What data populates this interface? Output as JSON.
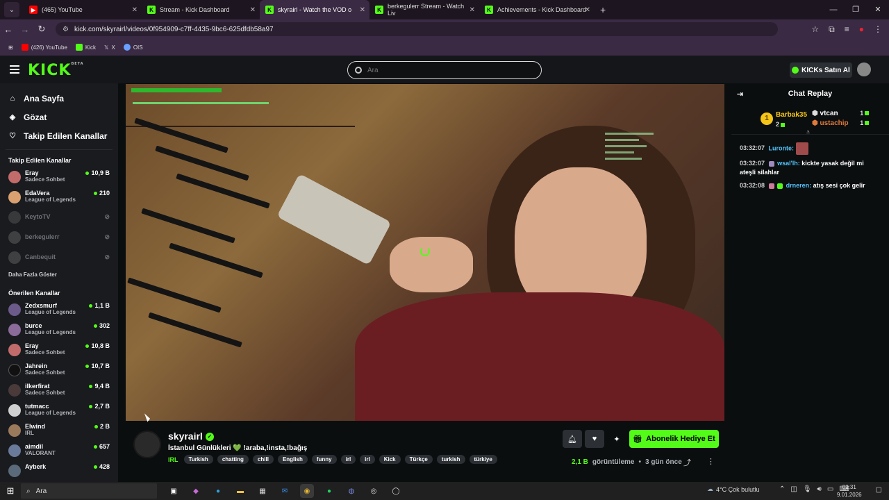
{
  "browser": {
    "tabs": [
      {
        "label": "(465) YouTube",
        "icon": "youtube-icon",
        "color": "#ff0000"
      },
      {
        "label": "Stream - Kick Dashboard",
        "icon": "kick-icon",
        "color": "#53fc18"
      },
      {
        "label": "skyrairl - Watch the VOD o",
        "icon": "kick-icon",
        "color": "#53fc18"
      },
      {
        "label": "berkegulerr Stream - Watch Liv",
        "icon": "kick-icon",
        "color": "#53fc18"
      },
      {
        "label": "Achievements - Kick Dashboard",
        "icon": "kick-icon",
        "color": "#53fc18"
      }
    ],
    "url": "kick.com/skyrairl/videos/0f954909-c7ff-4435-9bc6-625dfdb58a97",
    "bookmarks": [
      {
        "label": "(426) YouTube",
        "icon": "youtube-icon",
        "color": "#ff0000"
      },
      {
        "label": "Kick",
        "icon": "kick-icon",
        "color": "#53fc18"
      },
      {
        "label": "X",
        "icon": "x-icon",
        "color": "#ffffff"
      },
      {
        "label": "OIS",
        "icon": "globe-icon",
        "color": "#6aa0ff"
      }
    ]
  },
  "header": {
    "logo": "KICK",
    "logo_badge": "BETA",
    "search_placeholder": "Ara",
    "kicks_button": "KICKs Satın Al"
  },
  "sidebar": {
    "nav": [
      {
        "label": "Ana Sayfa",
        "icon": "home-icon"
      },
      {
        "label": "Gözat",
        "icon": "compass-icon"
      },
      {
        "label": "Takip Edilen Kanallar",
        "icon": "heart-icon"
      }
    ],
    "followed_title": "Takip Edilen Kanallar",
    "followed": [
      {
        "name": "Eray",
        "category": "Sadece Sohbet",
        "viewers": "10,9 B",
        "color": "#c26b6b"
      },
      {
        "name": "EdaVera",
        "category": "League of Legends",
        "viewers": "210",
        "color": "#d9a070"
      },
      {
        "name": "KeytoTV",
        "offline": true,
        "color": "#666"
      },
      {
        "name": "berkegulerr",
        "offline": true,
        "color": "#777"
      },
      {
        "name": "Canbequit",
        "offline": true,
        "color": "#777"
      }
    ],
    "show_more": "Daha Fazla Göster",
    "recommended_title": "Önerilen Kanallar",
    "recommended": [
      {
        "name": "Zedxsmurf",
        "category": "League of Legends",
        "viewers": "1,1 B",
        "color": "#6b5a8a"
      },
      {
        "name": "burce",
        "category": "League of Legends",
        "viewers": "302",
        "color": "#8a6b9a"
      },
      {
        "name": "Eray",
        "category": "Sadece Sohbet",
        "viewers": "10,8 B",
        "color": "#c26b6b"
      },
      {
        "name": "Jahrein",
        "category": "Sadece Sohbet",
        "viewers": "10,7 B",
        "color": "#111"
      },
      {
        "name": "ilkerfirat",
        "category": "Sadece Sohbet",
        "viewers": "9,4 B",
        "color": "#4a3a3a"
      },
      {
        "name": "tutmacc",
        "category": "League of Legends",
        "viewers": "2,7 B",
        "color": "#d0d0d0"
      },
      {
        "name": "Elwind",
        "category": "IRL",
        "viewers": "2 B",
        "color": "#9a7a5a"
      },
      {
        "name": "aimdil",
        "category": "VALORANT",
        "viewers": "657",
        "color": "#6a7a9a"
      },
      {
        "name": "Ayberk",
        "category": "",
        "viewers": "428",
        "color": "#5a6a7a"
      }
    ]
  },
  "stream": {
    "name": "skyrairl",
    "title": "İstanbul Günlükleri 💚  !araba,!insta,!bağış",
    "category": "IRL",
    "tags": [
      "Turkish",
      "chatting",
      "chill",
      "English",
      "funny",
      "irl",
      "irl",
      "Kick",
      "Türkçe",
      "turkish",
      "türkiye"
    ],
    "gift_button": "Abonelik Hediye Et",
    "views_num": "2,1 B",
    "views_label": "görüntüleme",
    "ago": "3 gün önce"
  },
  "chat": {
    "title": "Chat Replay",
    "leaderboard": {
      "top": {
        "name": "Barbak35",
        "count": "2",
        "rank": "1"
      },
      "others": [
        {
          "name": "vtcan",
          "count": "1"
        },
        {
          "name": "ustachip",
          "count": "1"
        }
      ]
    },
    "messages": [
      {
        "time": "03:32:07",
        "user": "Luronte:",
        "text": ""
      },
      {
        "time": "03:32:07",
        "user": "wsal'lh:",
        "text": "kickte yasak değil mi ateşli silahlar"
      },
      {
        "time": "03:32:08",
        "user": "drneren:",
        "text": "atış sesi çok gelir"
      }
    ]
  },
  "taskbar": {
    "search": "Ara",
    "weather": "4°C  Çok bulutlu",
    "time": "02:31",
    "date": "9.01.2026"
  }
}
